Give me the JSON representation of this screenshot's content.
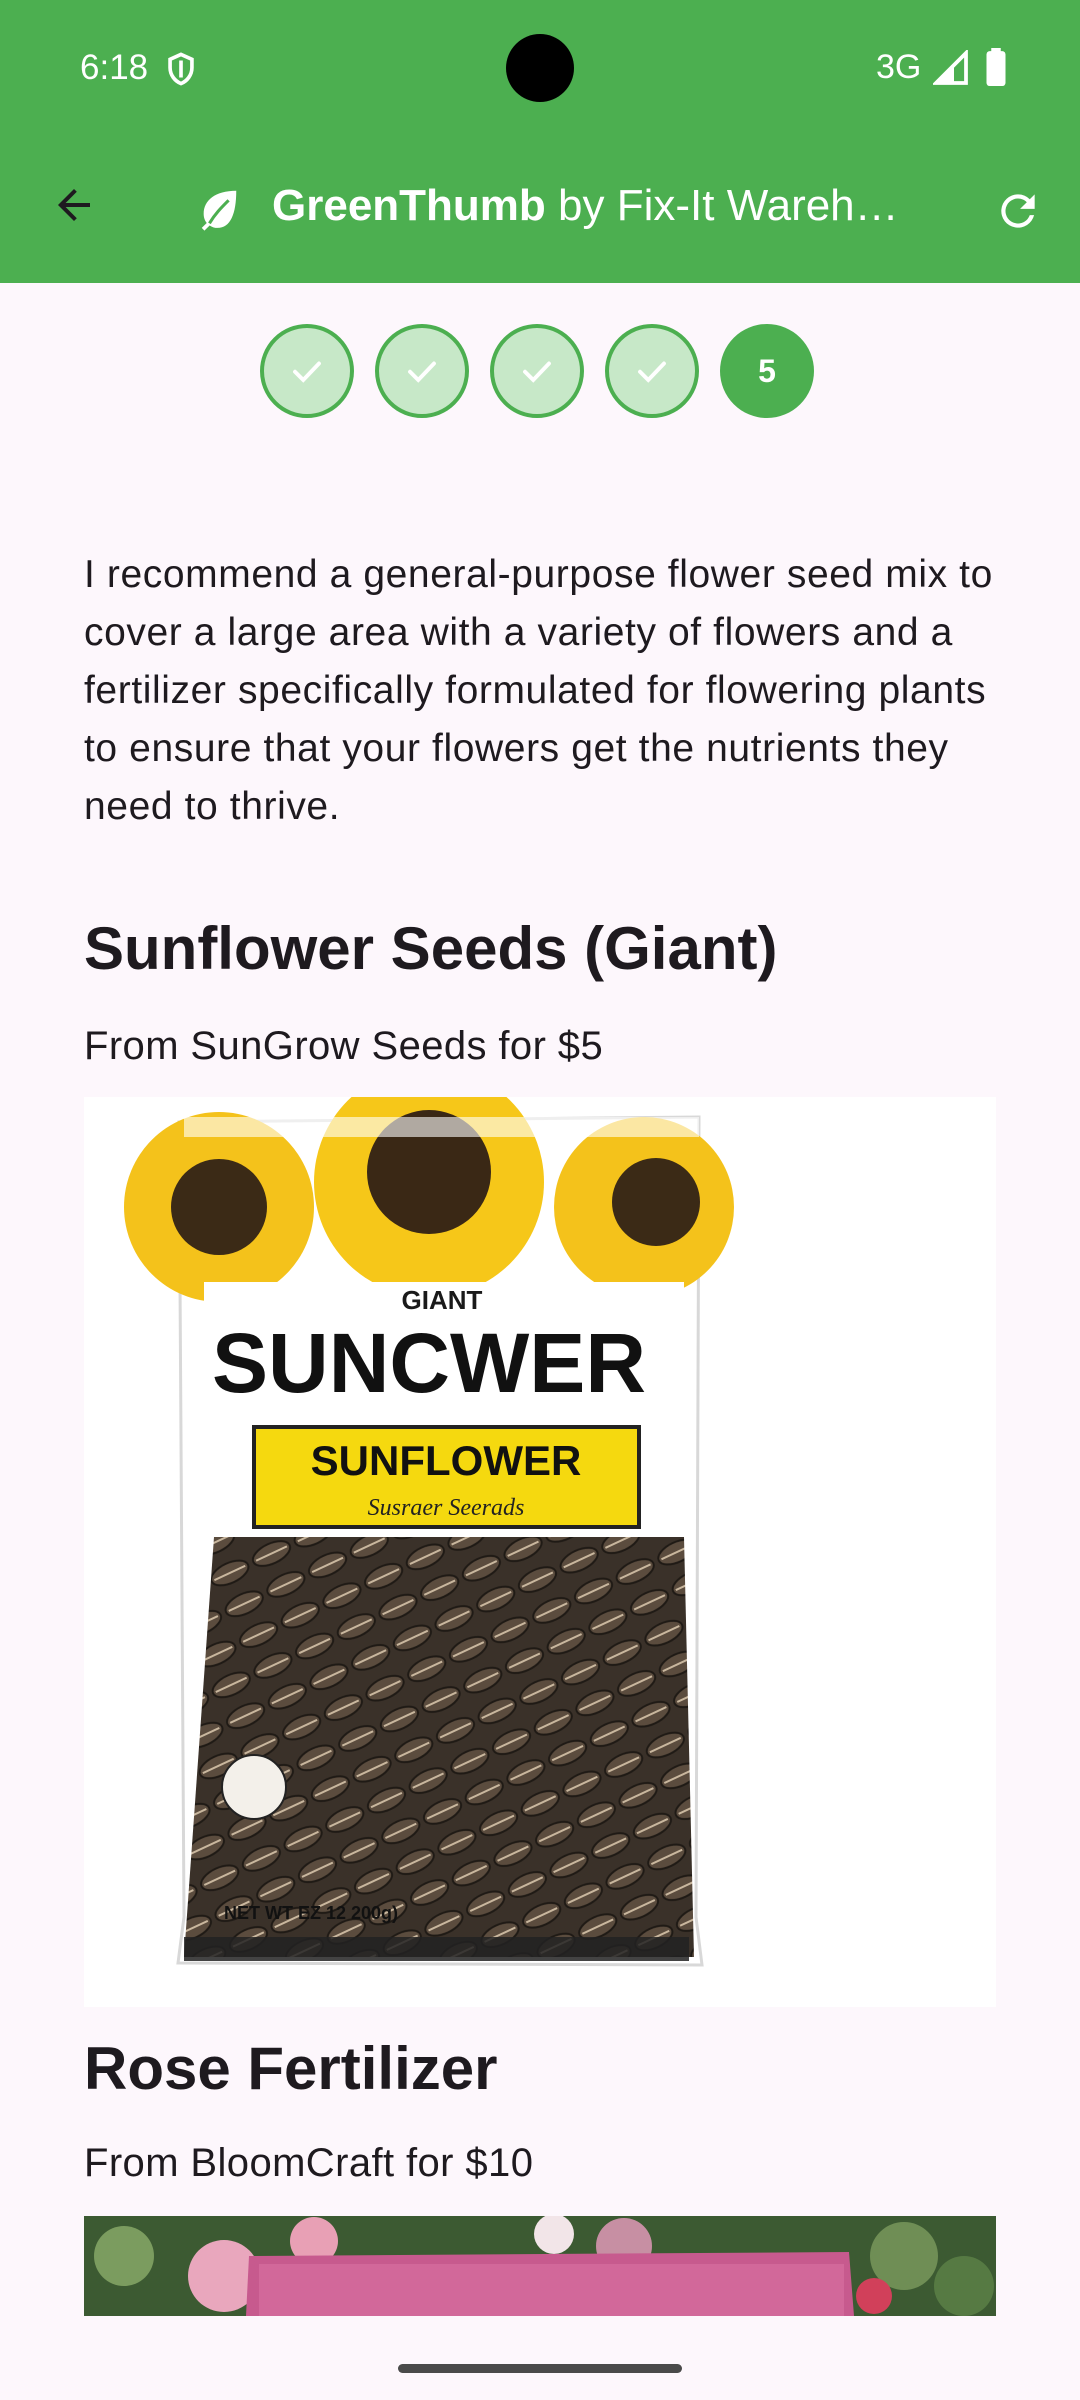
{
  "status": {
    "time": "6:18",
    "network": "3G"
  },
  "appbar": {
    "brand": "GreenThumb",
    "suffix": " by Fix-It Wareh…"
  },
  "stepper": {
    "current_step": "5",
    "completed_steps": 4
  },
  "intro_text": "I recommend a general-purpose flower seed mix to cover a large area with a variety of flowers and a fertilizer specifically formulated for flowering plants to ensure that your flowers get the nutrients they need to thrive.",
  "products": [
    {
      "name": "Sunflower Seeds (Giant)",
      "source": "From SunGrow Seeds for $5",
      "packaging": {
        "tag": "GIANT",
        "brand": "SUNCWER",
        "label": "SUNFLOWER",
        "sub": "Susraer Seerads",
        "weight": "NET WT EZ 12 200g)"
      }
    },
    {
      "name": "Rose Fertilizer",
      "source": "From BloomCraft for $10"
    }
  ],
  "colors": {
    "primary": "#4caf50",
    "step_done_fill": "#c7e8c8",
    "background": "#fdf7fc"
  }
}
